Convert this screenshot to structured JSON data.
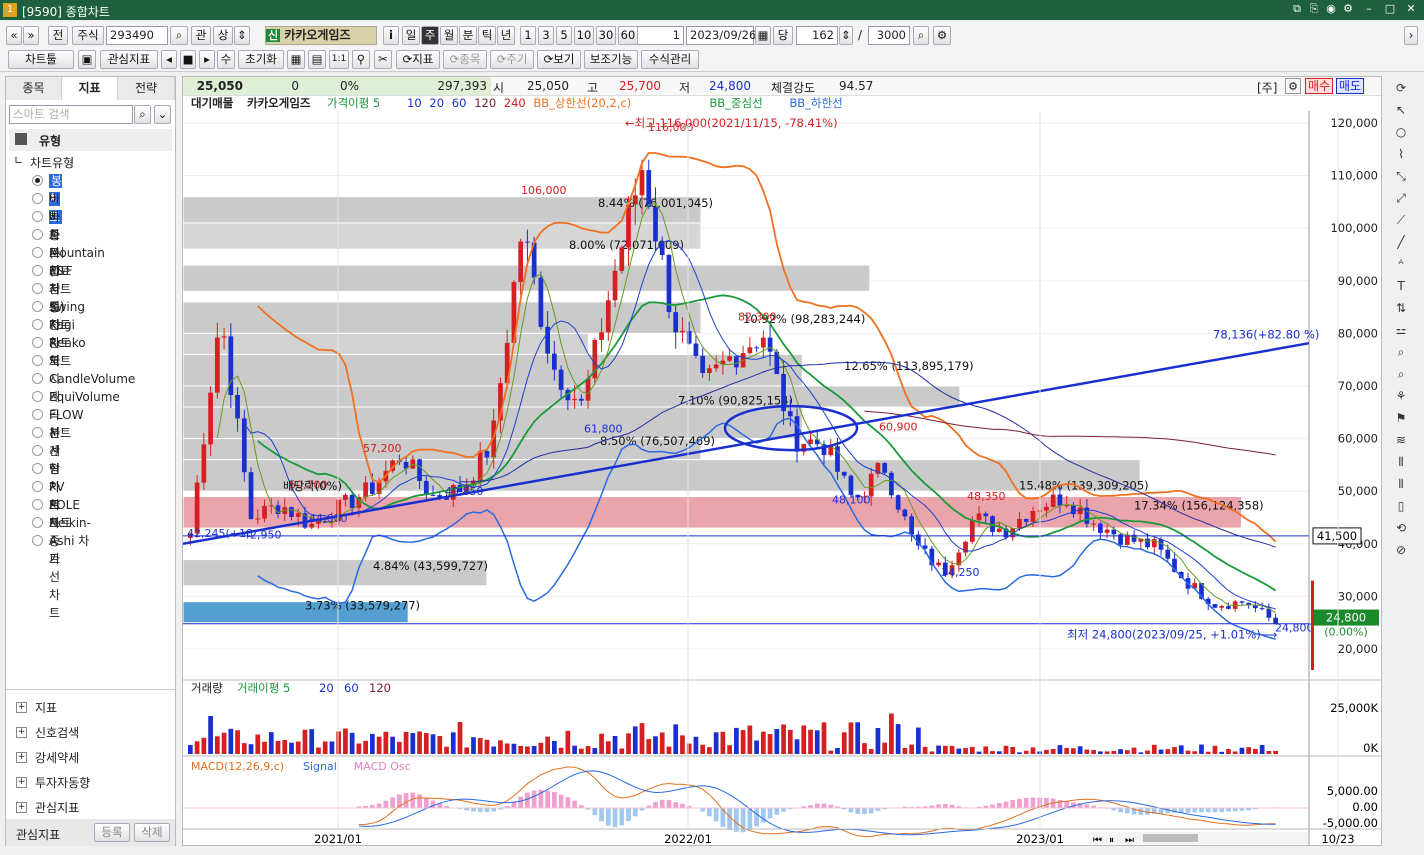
{
  "titlebar": {
    "code": "[9590] 종합차트"
  },
  "toolbar": {
    "nav_first": "«",
    "nav_prev": "»",
    "jeon": "전",
    "market": "주식",
    "stock_code": "293490",
    "search_icon": "⌕",
    "gwan": "관",
    "sang": "상",
    "shin": "신",
    "stock_name": "카카오게임즈",
    "info": "i",
    "periods": [
      "일",
      "주",
      "월",
      "분",
      "틱",
      "년"
    ],
    "active_period": "주",
    "minutes": [
      "1",
      "3",
      "5",
      "10",
      "30",
      "60"
    ],
    "count_field": "1",
    "date": "2023/09/26",
    "dang": "당",
    "bars": "162",
    "slash": "/",
    "max_bars": "3000"
  },
  "toolbar2": {
    "chart_tools": "차트툴",
    "watch_index": "관심지표",
    "su": "수",
    "reset": "초기화",
    "onebyone": "1:1",
    "indicator": "지표",
    "item": "종목",
    "period": "주기",
    "view": "보기",
    "aux": "보조기능",
    "formula": "수식관리"
  },
  "left": {
    "tabs": [
      "종목",
      "지표",
      "전략"
    ],
    "search_placeholder": "스마트 검색",
    "type_label": "유형",
    "chart_type_label": "차트유형",
    "chart_types": [
      "봉차트",
      "바차트(시고저종)",
      "바차트(고저종)",
      "종가선차트",
      "Mountain 차트",
      "P&F차트",
      "삼선전환도",
      "Swing차트",
      "Kagi차트",
      "Renko차트",
      "역시계곡선",
      "CandleVolume",
      "EquiVolume",
      "FLOW차트",
      "분산형차트",
      "계단 차트",
      "점 차트",
      "PV차트",
      "POLE차트",
      "Heikin-Ashi 차트",
      "종가선 차트"
    ],
    "bottom_items": [
      "지표",
      "신호검색",
      "강세약세",
      "투자자동향",
      "관심지표"
    ],
    "fav_label": "관심지표",
    "register": "등록",
    "delete": "삭제"
  },
  "quote": {
    "last": "25,050",
    "change": "0",
    "pct": "0%",
    "volume": "297,393",
    "open_label": "시",
    "open": "25,050",
    "high_label": "고",
    "high": "25,700",
    "low_label": "저",
    "low": "24,800",
    "strength_label": "체결강도",
    "strength": "94.57",
    "ju": "[주]",
    "buy": "매수",
    "sell": "매도"
  },
  "legend": {
    "items": [
      "대기매물",
      "카카오게임즈",
      "가격이평 5",
      "10",
      "20",
      "60",
      "120",
      "240",
      "BB_상한선(20,2,c)",
      "BB_중심선",
      "BB_하한선"
    ]
  },
  "volume_legend": [
    "거래량",
    "거래이평 5",
    "20",
    "60",
    "120"
  ],
  "macd_legend": [
    "MACD(12,26,9,c)",
    "Signal",
    "MACD Osc"
  ],
  "colors": {
    "up": "#d42020",
    "down": "#1a2fd0",
    "bb_upper": "#f07020",
    "bb_mid": "#1a9a3a",
    "bb_lower": "#2a6ae0",
    "trend": "#1a2fd0",
    "supply": "#c8c8c8",
    "supply_hot": "#e8a0a8",
    "supply_low": "#4a9ad0"
  },
  "chart_data": {
    "type": "candlestick",
    "y_ticks": [
      "120,000",
      "110,000",
      "100,000",
      "90,000",
      "80,000",
      "70,000",
      "60,000",
      "50,000",
      "40,000",
      "30,000",
      "20,000"
    ],
    "x_ticks": [
      "2021/01",
      "2022/01",
      "2023/01",
      "10/23"
    ],
    "volume_ticks": [
      "25,000K",
      "0K"
    ],
    "macd_ticks": [
      "5,000.00",
      "0.00",
      "-5,000.00"
    ],
    "supply_labels": [
      "8.44% (76,001,045)",
      "8.00% (72,071,609)",
      "10.92% (98,283,244)",
      "12.65% (113,895,179)",
      "7.10% (90,825,154)",
      "8.50% (76,507,469)",
      "15.48% (139,309,205)",
      "17.34% (156,124,358)",
      "4.84% (43,599,727)",
      "3.73% (33,579,277)"
    ],
    "price_labels": [
      "116,000",
      "106,000",
      "82,300",
      "60,900",
      "57,200",
      "50,700",
      "48,350",
      "42,950",
      "44,600",
      "49,850",
      "61,800",
      "48,100",
      "34,250",
      "24,800"
    ],
    "annotations": {
      "high": "←최고 116,000(2021/11/15, -78.41%)",
      "low": "최저 24,800(2023/09/25, +1.01%)⟶",
      "trend_value": "78,136(+82.80 %)",
      "dividend": "배당락(0%)",
      "left_label": "42,245(+18",
      "right_box": "41,500",
      "current": "24,800",
      "current_pct": "(0.00%)"
    }
  }
}
